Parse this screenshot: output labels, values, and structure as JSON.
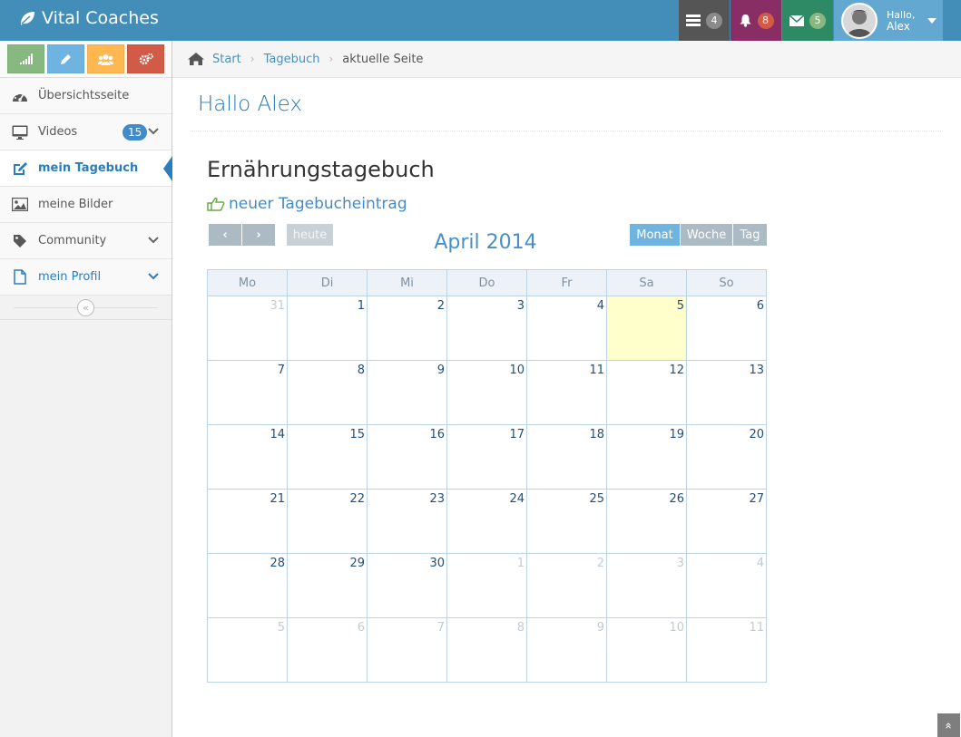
{
  "navbar": {
    "brand": "Vital Coaches",
    "tasks_count": "4",
    "notifications_count": "8",
    "messages_count": "5",
    "user_greeting": "Hallo,",
    "user_name": "Alex"
  },
  "sidebar": {
    "items": [
      {
        "label": "Übersichtsseite",
        "icon": "dashboard-icon"
      },
      {
        "label": "Videos",
        "icon": "desktop-icon",
        "badge": "15"
      },
      {
        "label": "mein Tagebuch",
        "icon": "pencil-square-icon"
      },
      {
        "label": "meine Bilder",
        "icon": "picture-icon"
      },
      {
        "label": "Community",
        "icon": "tag-icon"
      },
      {
        "label": "mein Profil",
        "icon": "file-icon"
      }
    ]
  },
  "breadcrumb": {
    "home": "Start",
    "section": "Tagebuch",
    "current": "aktuelle Seite"
  },
  "page": {
    "title": "Hallo Alex",
    "section_title": "Ernährungstagebuch",
    "new_entry": "neuer Tagebucheintrag"
  },
  "calendar": {
    "prev": "‹",
    "next": "›",
    "today_btn": "heute",
    "month_btn": "Monat",
    "week_btn": "Woche",
    "day_btn": "Tag",
    "title": "April 2014",
    "weekdays": [
      "Mo",
      "Di",
      "Mi",
      "Do",
      "Fr",
      "Sa",
      "So"
    ],
    "weeks": [
      [
        "31",
        "1",
        "2",
        "3",
        "4",
        "5",
        "6"
      ],
      [
        "7",
        "8",
        "9",
        "10",
        "11",
        "12",
        "13"
      ],
      [
        "14",
        "15",
        "16",
        "17",
        "18",
        "19",
        "20"
      ],
      [
        "21",
        "22",
        "23",
        "24",
        "25",
        "26",
        "27"
      ],
      [
        "28",
        "29",
        "30",
        "1",
        "2",
        "3",
        "4"
      ],
      [
        "5",
        "6",
        "7",
        "8",
        "9",
        "10",
        "11"
      ]
    ]
  },
  "colors": {
    "navbar": "#438eb9",
    "accent": "#2b7dbc",
    "today_cell": "#ffffcc"
  }
}
